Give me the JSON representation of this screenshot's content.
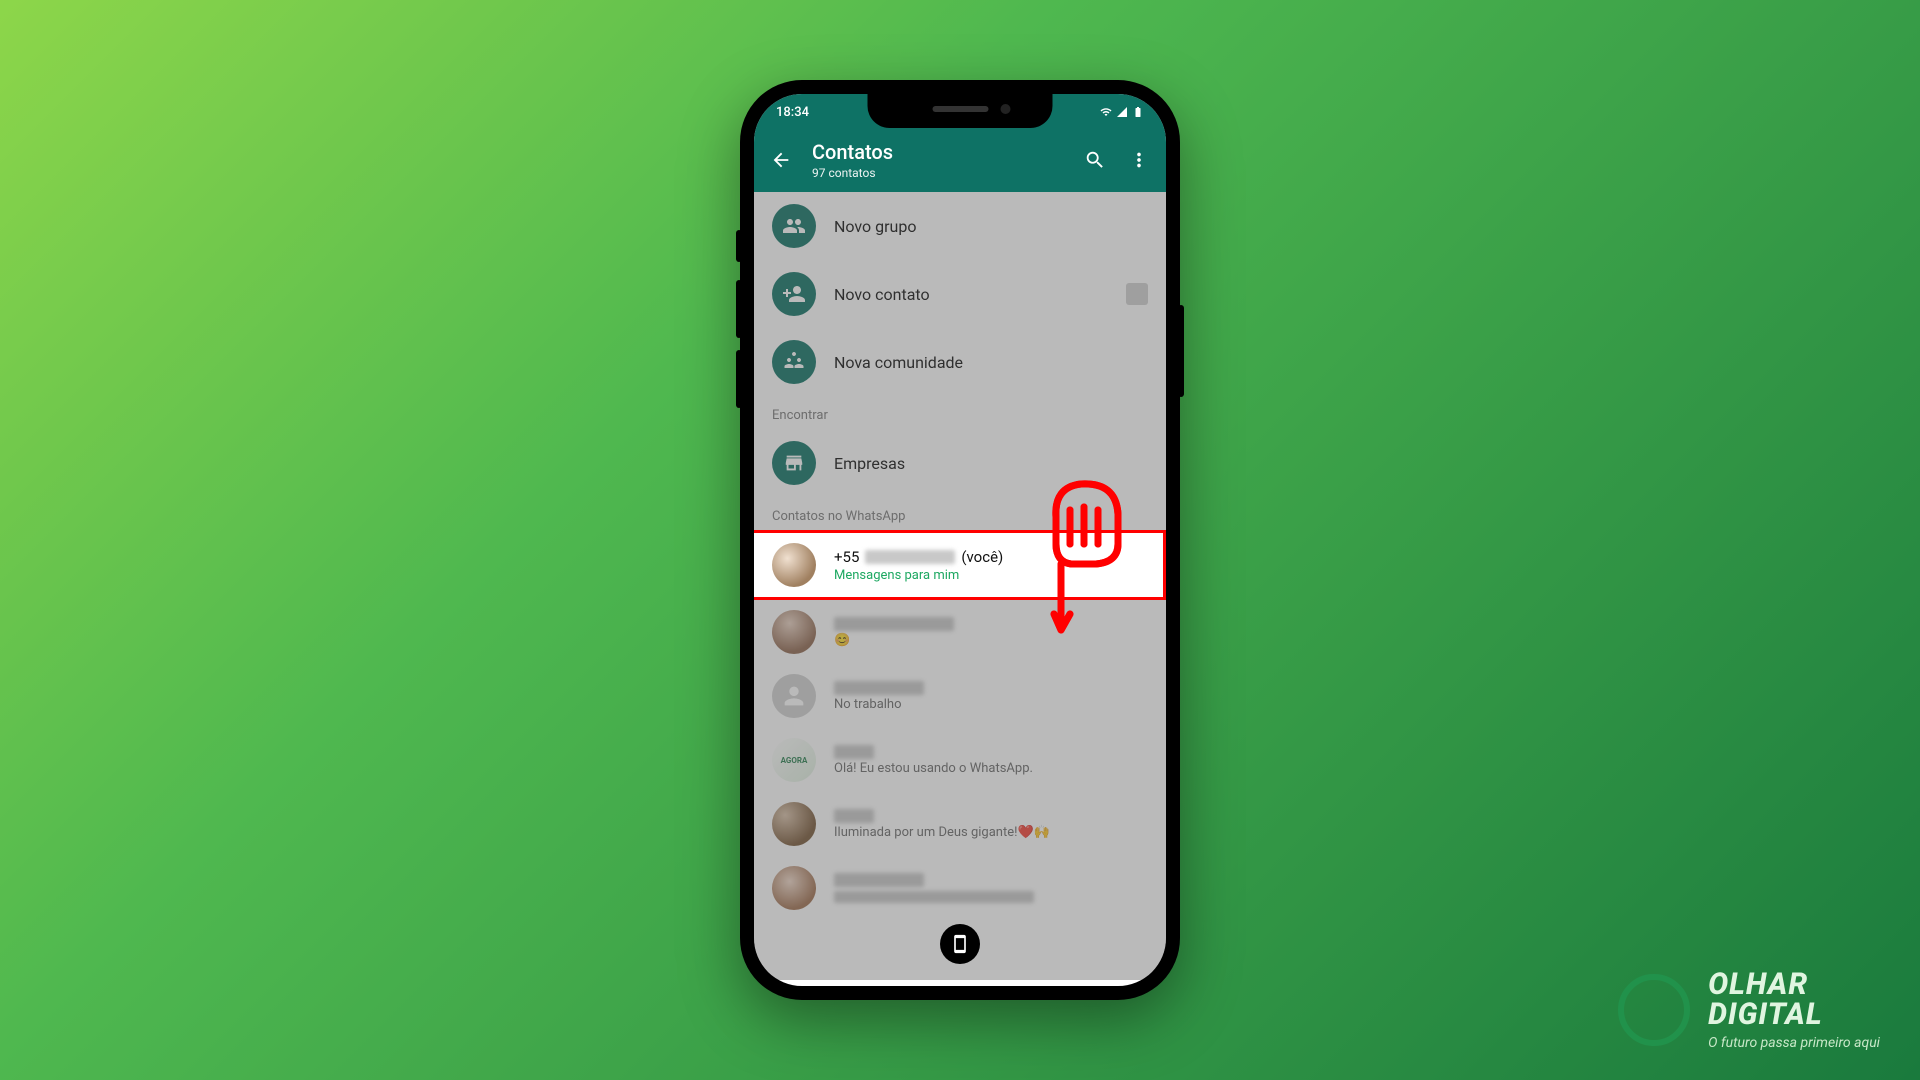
{
  "status_bar": {
    "time": "18:34"
  },
  "header": {
    "title": "Contatos",
    "subtitle": "97 contatos"
  },
  "actions": {
    "new_group": "Novo grupo",
    "new_contact": "Novo contato",
    "new_community": "Nova comunidade",
    "businesses": "Empresas"
  },
  "sections": {
    "find": "Encontrar",
    "on_whatsapp": "Contatos no WhatsApp"
  },
  "self_contact": {
    "prefix": "+55",
    "suffix": "(você)",
    "status": "Mensagens para mim"
  },
  "contact_statuses": {
    "c2": "No trabalho",
    "c3": "Olá! Eu estou usando o WhatsApp.",
    "c4": "Iluminada por um Deus gigante!❤️🙌"
  },
  "brand": {
    "line1": "OLHAR",
    "line2": "DIGITAL",
    "tag": "O futuro passa primeiro aqui"
  }
}
